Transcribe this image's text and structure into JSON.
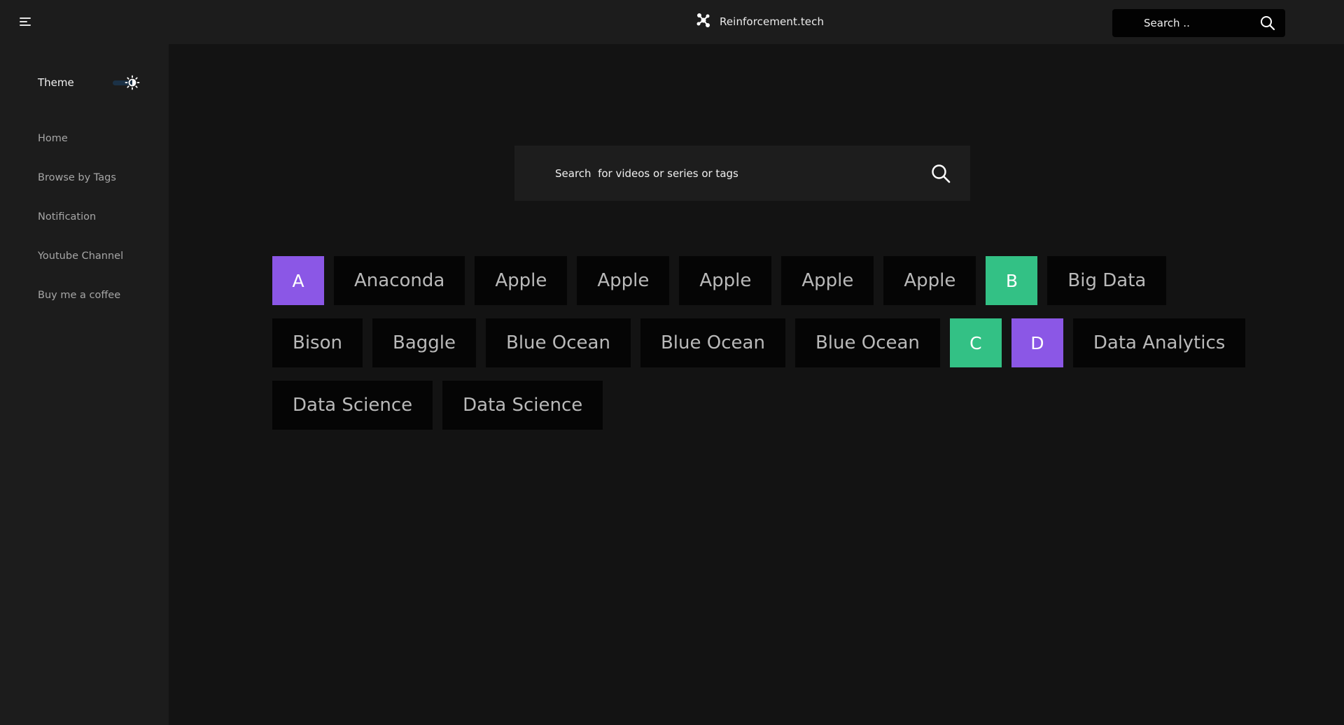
{
  "header": {
    "brand_name": "Reinforcement.tech",
    "search_placeholder": "Search ..",
    "menu_icon": "hamburger-menu-icon",
    "logo_icon": "molecule-logo-icon",
    "search_icon": "search-icon"
  },
  "sidebar": {
    "theme_label": "Theme",
    "theme_icon": "sun-icon",
    "items": [
      {
        "label": "Home"
      },
      {
        "label": "Browse by Tags"
      },
      {
        "label": "Notification"
      },
      {
        "label": "Youtube Channel"
      },
      {
        "label": "Buy me a coffee"
      }
    ]
  },
  "main": {
    "search_placeholder": "Search  for videos or series or tags",
    "tags": [
      {
        "label": "A",
        "kind": "letter",
        "color": "#8b57e6"
      },
      {
        "label": "Anaconda",
        "kind": "tag"
      },
      {
        "label": "Apple",
        "kind": "tag"
      },
      {
        "label": "Apple",
        "kind": "tag"
      },
      {
        "label": "Apple",
        "kind": "tag"
      },
      {
        "label": "Apple",
        "kind": "tag"
      },
      {
        "label": "Apple",
        "kind": "tag"
      },
      {
        "label": "B",
        "kind": "letter",
        "color": "#33c185"
      },
      {
        "label": "Big Data",
        "kind": "tag"
      },
      {
        "label": "Bison",
        "kind": "tag"
      },
      {
        "label": "Baggle",
        "kind": "tag"
      },
      {
        "label": "Blue Ocean",
        "kind": "tag"
      },
      {
        "label": "Blue Ocean",
        "kind": "tag"
      },
      {
        "label": "Blue Ocean",
        "kind": "tag"
      },
      {
        "label": "C",
        "kind": "letter",
        "color": "#33c185"
      },
      {
        "label": "D",
        "kind": "letter",
        "color": "#8b57e6"
      },
      {
        "label": "Data Analytics",
        "kind": "tag"
      },
      {
        "label": "Data Science",
        "kind": "tag"
      },
      {
        "label": "Data Science",
        "kind": "tag"
      }
    ]
  },
  "colors": {
    "background": "#131313",
    "panel": "#1c1c1c",
    "tag_background": "#050505",
    "purple": "#8b57e6",
    "green": "#33c185"
  }
}
